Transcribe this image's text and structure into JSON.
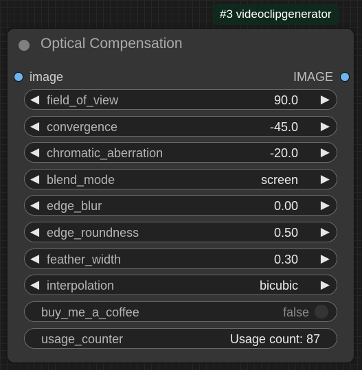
{
  "badge": {
    "text": "#3 videoclipgenerator"
  },
  "node": {
    "title": "Optical Compensation",
    "input_slot": {
      "label": "image"
    },
    "output_slot": {
      "label": "IMAGE"
    },
    "widgets": [
      {
        "label": "field_of_view",
        "value": "90.0"
      },
      {
        "label": "convergence",
        "value": "-45.0"
      },
      {
        "label": "chromatic_aberration",
        "value": "-20.0"
      },
      {
        "label": "blend_mode",
        "value": "screen"
      },
      {
        "label": "edge_blur",
        "value": "0.00"
      },
      {
        "label": "edge_roundness",
        "value": "0.50"
      },
      {
        "label": "feather_width",
        "value": "0.30"
      },
      {
        "label": "interpolation",
        "value": "bicubic"
      }
    ],
    "toggle": {
      "label": "buy_me_a_coffee",
      "value": "false"
    },
    "counter": {
      "label": "usage_counter",
      "value": "Usage count: 87"
    }
  },
  "icons": {
    "decrement": "left-arrow-icon",
    "increment": "right-arrow-icon",
    "slot": "slot-dot-icon"
  },
  "colors": {
    "slot": "#6fb4f0",
    "badge_bg": "#0f2a1c",
    "node_bg": "#353535",
    "widget_bg": "#222222"
  }
}
